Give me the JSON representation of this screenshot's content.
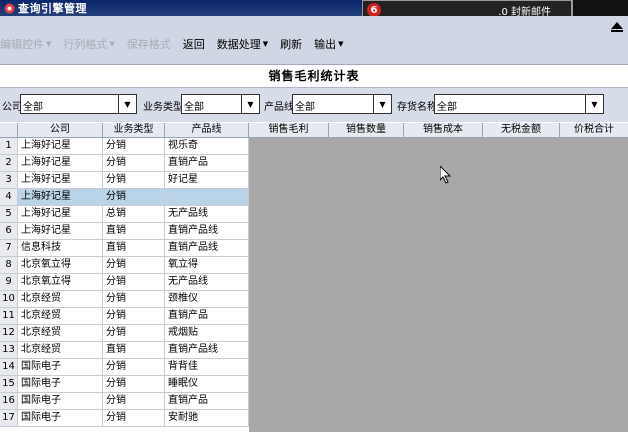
{
  "window": {
    "title": "查询引擎管理"
  },
  "notification": {
    "text": ".0 封新邮件",
    "icon": "notify-icon"
  },
  "menu": [
    {
      "label": "编辑控件",
      "disabled": true,
      "dropdown": true
    },
    {
      "label": "行列格式",
      "disabled": true,
      "dropdown": true
    },
    {
      "label": "保存格式",
      "disabled": true,
      "dropdown": false
    },
    {
      "label": "返回",
      "disabled": false,
      "dropdown": false
    },
    {
      "label": "数据处理",
      "disabled": false,
      "dropdown": true
    },
    {
      "label": "刷新",
      "disabled": false,
      "dropdown": false
    },
    {
      "label": "输出",
      "disabled": false,
      "dropdown": true
    }
  ],
  "report_title": "销售毛利统计表",
  "filters": {
    "company_label": "公司",
    "company_value": "全部",
    "biztype_label": "业务类型",
    "biztype_value": "全部",
    "line_label": "产品线",
    "line_value": "全部",
    "goods_label": "存货名称",
    "goods_value": "全部"
  },
  "table": {
    "headers": [
      "公司",
      "业务类型",
      "产品线",
      "销售毛利",
      "销售数量",
      "销售成本",
      "无税金额",
      "价税合计"
    ],
    "selected_row": 4,
    "rows": [
      [
        "1",
        "上海好记星",
        "分销",
        "视乐奇"
      ],
      [
        "2",
        "上海好记星",
        "分销",
        "直销产品"
      ],
      [
        "3",
        "上海好记星",
        "分销",
        "好记星"
      ],
      [
        "4",
        "上海好记星",
        "分销",
        ""
      ],
      [
        "5",
        "上海好记星",
        "总销",
        "无产品线"
      ],
      [
        "6",
        "上海好记星",
        "直销",
        "直销产品线"
      ],
      [
        "7",
        "信息科技",
        "直销",
        "直销产品线"
      ],
      [
        "8",
        "北京氧立得",
        "分销",
        "氧立得"
      ],
      [
        "9",
        "北京氧立得",
        "分销",
        "无产品线"
      ],
      [
        "10",
        "北京经贸",
        "分销",
        "颈椎仪"
      ],
      [
        "11",
        "北京经贸",
        "分销",
        "直销产品"
      ],
      [
        "12",
        "北京经贸",
        "分销",
        "戒烟贴"
      ],
      [
        "13",
        "北京经贸",
        "直销",
        "直销产品线"
      ],
      [
        "14",
        "国际电子",
        "分销",
        "背背佳"
      ],
      [
        "15",
        "国际电子",
        "分销",
        "睡眠仪"
      ],
      [
        "16",
        "国际电子",
        "分销",
        "直销产品"
      ],
      [
        "17",
        "国际电子",
        "分销",
        "安耐驰"
      ]
    ]
  }
}
